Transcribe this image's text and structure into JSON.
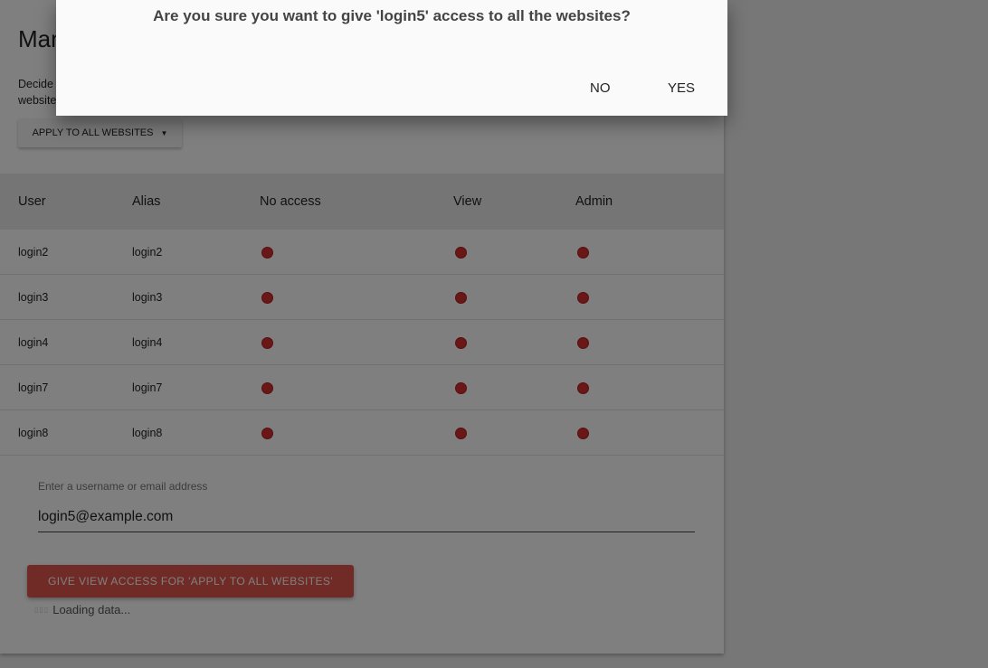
{
  "page": {
    "title": "Manage",
    "description_line1": "Decide",
    "description_line2": "website",
    "apply_dropdown": "APPLY TO ALL WEBSITES"
  },
  "table": {
    "headers": [
      "User",
      "Alias",
      "No access",
      "View",
      "Admin"
    ],
    "rows": [
      {
        "user": "login2",
        "alias": "login2"
      },
      {
        "user": "login3",
        "alias": "login3"
      },
      {
        "user": "login4",
        "alias": "login4"
      },
      {
        "user": "login7",
        "alias": "login7"
      },
      {
        "user": "login8",
        "alias": "login8"
      }
    ]
  },
  "form": {
    "label": "Enter a username or email address",
    "value": "login5@example.com",
    "give_button": "GIVE VIEW ACCESS FOR 'APPLY TO ALL WEBSITES'",
    "loading": "Loading data..."
  },
  "dialog": {
    "message": "Are you sure you want to give 'login5' access to all the websites?",
    "no": "NO",
    "yes": "YES"
  },
  "colors": {
    "accent": "#e0574d",
    "radio": "#d32f2f"
  }
}
